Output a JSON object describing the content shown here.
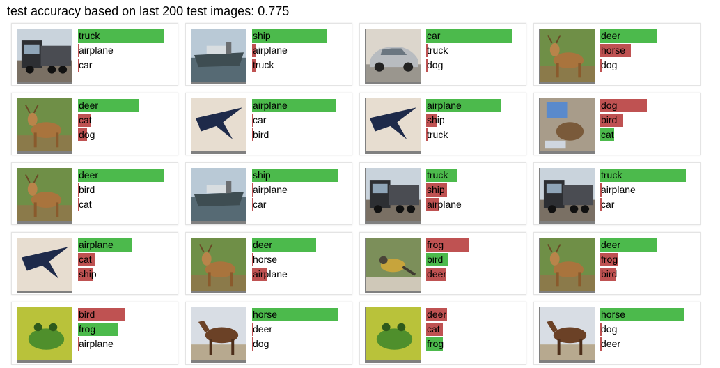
{
  "header": {
    "text": "test accuracy based on last 200 test images: 0.775"
  },
  "colors": {
    "correct": "#4cba4c",
    "incorrect": "#bf5252"
  },
  "cards": [
    {
      "image": "truck",
      "preds": [
        {
          "label": "truck",
          "p": 0.98,
          "c": "g"
        },
        {
          "label": "airplane",
          "p": 0.01,
          "c": "r"
        },
        {
          "label": "car",
          "p": 0.01,
          "c": "r"
        }
      ]
    },
    {
      "image": "ship",
      "preds": [
        {
          "label": "ship",
          "p": 0.86,
          "c": "g"
        },
        {
          "label": "airplane",
          "p": 0.04,
          "c": "r"
        },
        {
          "label": "truck",
          "p": 0.05,
          "c": "r"
        }
      ]
    },
    {
      "image": "car",
      "preds": [
        {
          "label": "car",
          "p": 0.98,
          "c": "g"
        },
        {
          "label": "truck",
          "p": 0.01,
          "c": "r"
        },
        {
          "label": "dog",
          "p": 0.01,
          "c": "r"
        }
      ]
    },
    {
      "image": "deer",
      "preds": [
        {
          "label": "deer",
          "p": 0.65,
          "c": "g"
        },
        {
          "label": "horse",
          "p": 0.35,
          "c": "r"
        },
        {
          "label": "dog",
          "p": 0.01,
          "c": "r"
        }
      ]
    },
    {
      "image": "deer",
      "preds": [
        {
          "label": "deer",
          "p": 0.69,
          "c": "g"
        },
        {
          "label": "cat",
          "p": 0.15,
          "c": "r"
        },
        {
          "label": "dog",
          "p": 0.1,
          "c": "r"
        }
      ]
    },
    {
      "image": "airplane",
      "preds": [
        {
          "label": "airplane",
          "p": 0.96,
          "c": "g"
        },
        {
          "label": "car",
          "p": 0.01,
          "c": "r"
        },
        {
          "label": "bird",
          "p": 0.01,
          "c": "r"
        }
      ]
    },
    {
      "image": "airplane",
      "preds": [
        {
          "label": "airplane",
          "p": 0.86,
          "c": "g"
        },
        {
          "label": "ship",
          "p": 0.12,
          "c": "r"
        },
        {
          "label": "truck",
          "p": 0.01,
          "c": "r"
        }
      ]
    },
    {
      "image": "cat",
      "preds": [
        {
          "label": "dog",
          "p": 0.53,
          "c": "r"
        },
        {
          "label": "bird",
          "p": 0.26,
          "c": "r"
        },
        {
          "label": "cat",
          "p": 0.16,
          "c": "g"
        }
      ]
    },
    {
      "image": "deer",
      "preds": [
        {
          "label": "deer",
          "p": 0.98,
          "c": "g"
        },
        {
          "label": "bird",
          "p": 0.01,
          "c": "r"
        },
        {
          "label": "cat",
          "p": 0.01,
          "c": "r"
        }
      ]
    },
    {
      "image": "ship",
      "preds": [
        {
          "label": "ship",
          "p": 0.98,
          "c": "g"
        },
        {
          "label": "airplane",
          "p": 0.01,
          "c": "r"
        },
        {
          "label": "car",
          "p": 0.01,
          "c": "r"
        }
      ]
    },
    {
      "image": "truck",
      "preds": [
        {
          "label": "truck",
          "p": 0.35,
          "c": "g"
        },
        {
          "label": "ship",
          "p": 0.24,
          "c": "r"
        },
        {
          "label": "airplane",
          "p": 0.14,
          "c": "r"
        }
      ]
    },
    {
      "image": "truck",
      "preds": [
        {
          "label": "truck",
          "p": 0.98,
          "c": "g"
        },
        {
          "label": "airplane",
          "p": 0.01,
          "c": "r"
        },
        {
          "label": "car",
          "p": 0.01,
          "c": "r"
        }
      ]
    },
    {
      "image": "airplane",
      "preds": [
        {
          "label": "airplane",
          "p": 0.61,
          "c": "g"
        },
        {
          "label": "cat",
          "p": 0.19,
          "c": "r"
        },
        {
          "label": "ship",
          "p": 0.17,
          "c": "r"
        }
      ]
    },
    {
      "image": "deer",
      "preds": [
        {
          "label": "deer",
          "p": 0.73,
          "c": "g"
        },
        {
          "label": "horse",
          "p": 0.01,
          "c": "r"
        },
        {
          "label": "airplane",
          "p": 0.17,
          "c": "r"
        }
      ]
    },
    {
      "image": "bird",
      "preds": [
        {
          "label": "frog",
          "p": 0.49,
          "c": "r"
        },
        {
          "label": "bird",
          "p": 0.25,
          "c": "g"
        },
        {
          "label": "deer",
          "p": 0.23,
          "c": "r"
        }
      ]
    },
    {
      "image": "deer",
      "preds": [
        {
          "label": "deer",
          "p": 0.65,
          "c": "g"
        },
        {
          "label": "frog",
          "p": 0.21,
          "c": "r"
        },
        {
          "label": "bird",
          "p": 0.18,
          "c": "r"
        }
      ]
    },
    {
      "image": "frog",
      "preds": [
        {
          "label": "bird",
          "p": 0.53,
          "c": "r"
        },
        {
          "label": "frog",
          "p": 0.46,
          "c": "g"
        },
        {
          "label": "airplane",
          "p": 0.01,
          "c": "r"
        }
      ]
    },
    {
      "image": "horse",
      "preds": [
        {
          "label": "horse",
          "p": 0.98,
          "c": "g"
        },
        {
          "label": "deer",
          "p": 0.01,
          "c": "r"
        },
        {
          "label": "dog",
          "p": 0.01,
          "c": "r"
        }
      ]
    },
    {
      "image": "frog",
      "preds": [
        {
          "label": "deer",
          "p": 0.24,
          "c": "r"
        },
        {
          "label": "cat",
          "p": 0.19,
          "c": "r"
        },
        {
          "label": "frog",
          "p": 0.19,
          "c": "g"
        }
      ]
    },
    {
      "image": "horse",
      "preds": [
        {
          "label": "horse",
          "p": 0.96,
          "c": "g"
        },
        {
          "label": "dog",
          "p": 0.01,
          "c": "r"
        },
        {
          "label": "deer",
          "p": 0.01,
          "c": "r"
        }
      ]
    }
  ]
}
